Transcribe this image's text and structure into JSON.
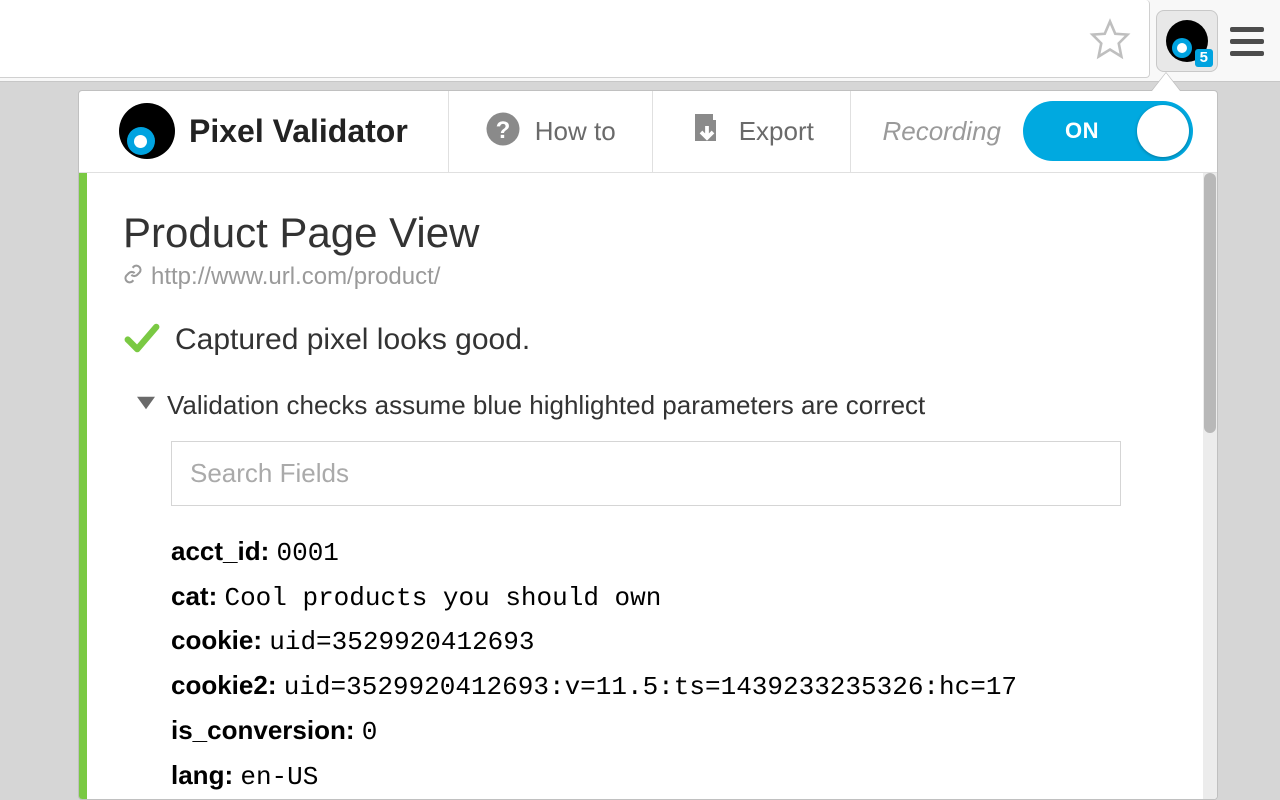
{
  "browser": {
    "extension_badge": "5"
  },
  "header": {
    "title": "Pixel Validator",
    "howto_label": "How to",
    "export_label": "Export",
    "recording_label": "Recording",
    "toggle_state": "ON"
  },
  "content": {
    "title": "Product Page View",
    "url": "http://www.url.com/product/",
    "status_text": "Captured pixel looks good.",
    "disclosure_text": "Validation checks assume blue highlighted parameters are correct",
    "search_placeholder": "Search Fields",
    "fields": [
      {
        "key": "acct_id:",
        "value": "0001"
      },
      {
        "key": "cat:",
        "value": "Cool products you should own"
      },
      {
        "key": "cookie:",
        "value": "uid=3529920412693"
      },
      {
        "key": "cookie2:",
        "value": "uid=3529920412693:v=11.5:ts=1439233235326:hc=17"
      },
      {
        "key": "is_conversion:",
        "value": "0"
      },
      {
        "key": "lang:",
        "value": "en-US"
      }
    ]
  }
}
